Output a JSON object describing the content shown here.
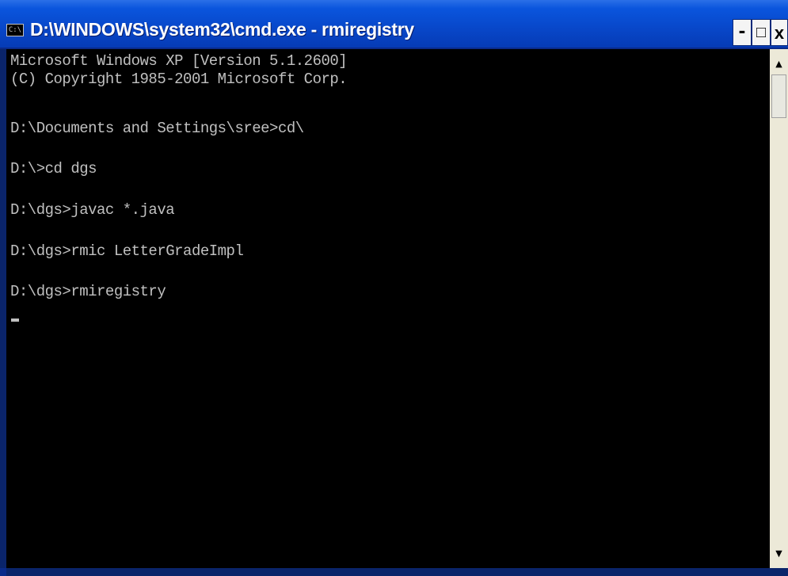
{
  "window": {
    "title": "D:\\WINDOWS\\system32\\cmd.exe - rmiregistry",
    "system_icon_label": "C:\\",
    "buttons": {
      "minimize": "-",
      "maximize": "□",
      "close": "x"
    }
  },
  "console": {
    "lines": [
      "Microsoft Windows XP [Version 5.1.2600]",
      "(C) Copyright 1985-2001 Microsoft Corp.",
      "",
      "D:\\Documents and Settings\\sree>cd\\",
      "",
      "D:\\>cd dgs",
      "",
      "D:\\dgs>javac *.java",
      "",
      "D:\\dgs>rmic LetterGradeImpl",
      "",
      "D:\\dgs>rmiregistry"
    ]
  },
  "scrollbar": {
    "up_arrow": "▲",
    "down_arrow": "▼"
  },
  "colors": {
    "titlebar": "#0847c9",
    "console_bg": "#000000",
    "console_text": "#c0c0c0",
    "scrollbar_bg": "#ece9d8"
  }
}
